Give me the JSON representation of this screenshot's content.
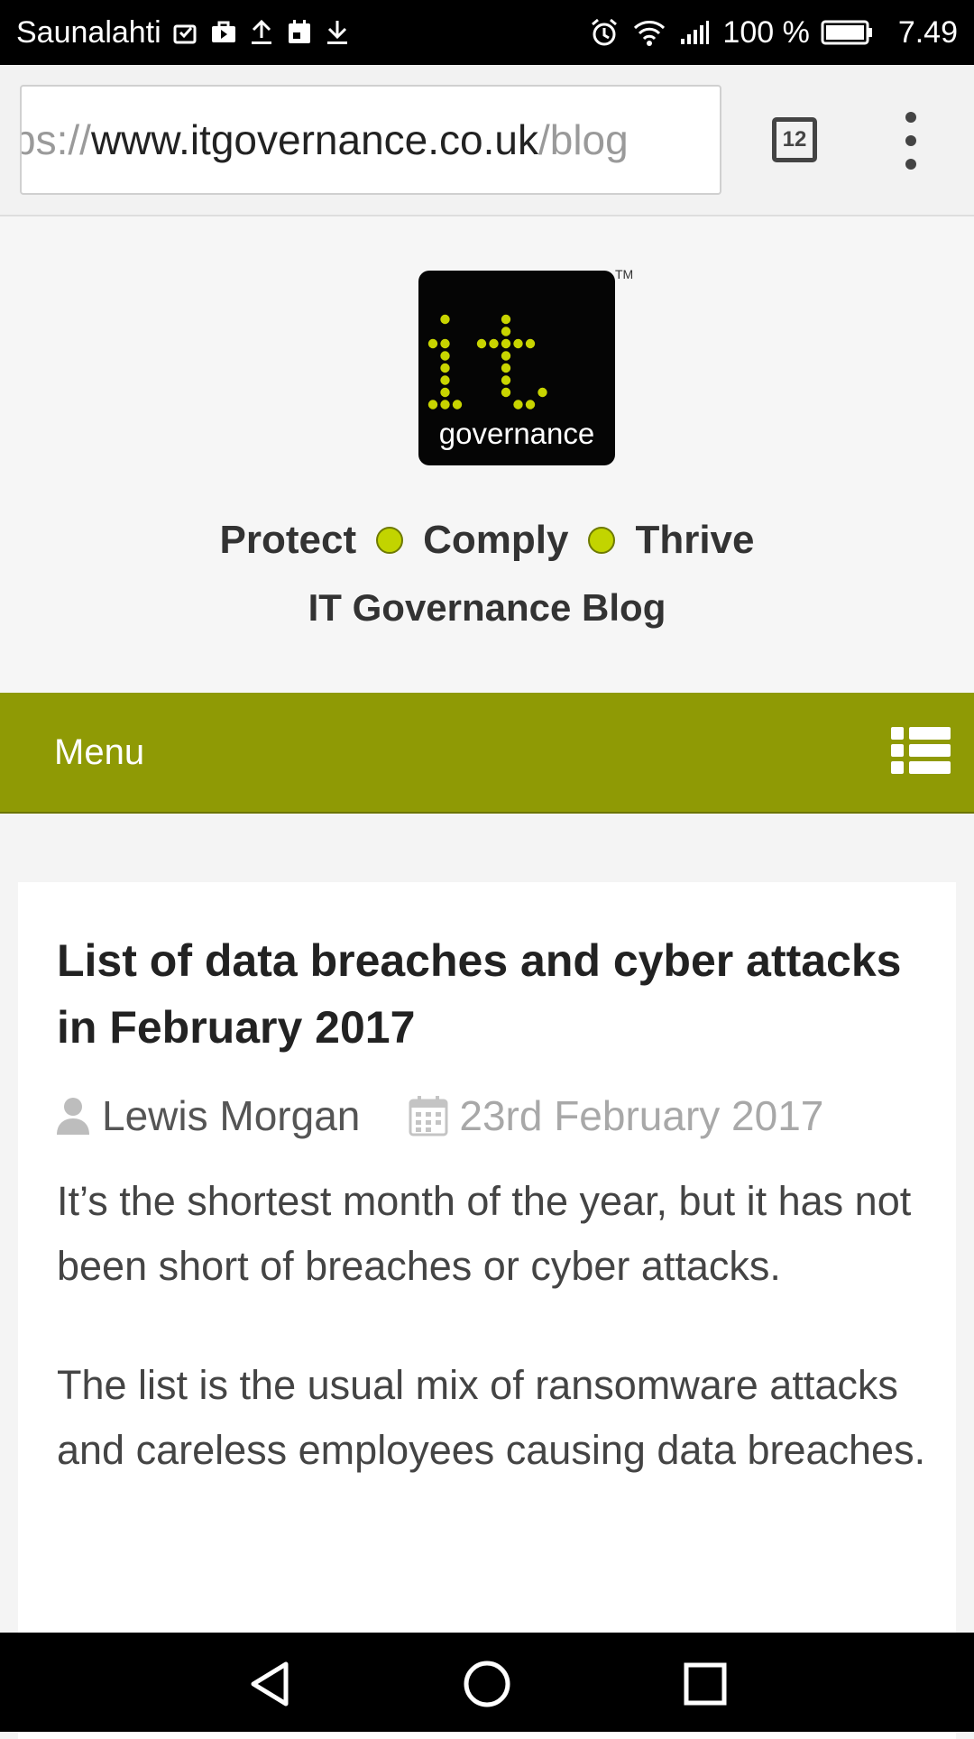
{
  "status_bar": {
    "carrier": "Saunalahti",
    "battery": "100 %",
    "time": "7.49",
    "icons_left": [
      "message-check-icon",
      "briefcase-icon",
      "upload-icon",
      "calendar-icon",
      "download-icon"
    ],
    "icons_right": [
      "alarm-icon",
      "wifi-icon",
      "signal-icon",
      "battery-icon"
    ]
  },
  "browser": {
    "url_scheme": "ps://",
    "url_host": "www.itgovernance.co.uk",
    "url_path": "/blog",
    "tab_count": "12"
  },
  "site": {
    "logo_text": "governance",
    "trademark": "TM",
    "tagline": [
      "Protect",
      "Comply",
      "Thrive"
    ],
    "blog_title": "IT Governance Blog",
    "accent_color": "#8f9a05",
    "dot_color": "#c2d400"
  },
  "menu": {
    "label": "Menu"
  },
  "article": {
    "title": "List of data breaches and cyber attacks in February 2017",
    "author": "Lewis Morgan",
    "date": "23rd February 2017",
    "paragraphs": [
      "It’s the shortest month of the year, but it has not been short of breaches or cyber attacks.",
      "The list is the usual mix of ransomware attacks and careless employees causing data breaches."
    ]
  }
}
